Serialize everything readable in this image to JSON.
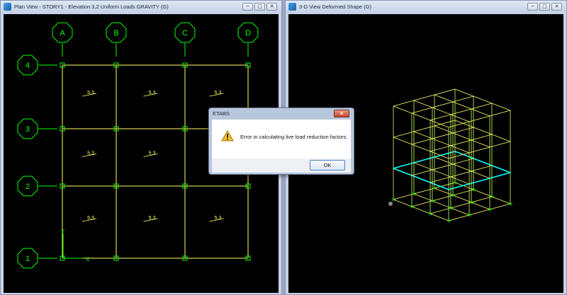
{
  "plan_window": {
    "title": "Plan View - STORY1 - Elevation 3,2  Uniform Loads GRAVITY   (G)",
    "grid_columns": [
      "A",
      "B",
      "C",
      "D"
    ],
    "grid_rows": [
      "4",
      "3",
      "2",
      "1"
    ],
    "load_label": "5.3",
    "axis_x_label": "X",
    "axis_y_label": "Y",
    "controls": {
      "minimize": "─",
      "maximize": "□",
      "close": "✕"
    }
  },
  "view3d_window": {
    "title": "3-D View  Deformed Shape (G)",
    "controls": {
      "minimize": "─",
      "maximize": "□",
      "close": "✕"
    }
  },
  "dialog": {
    "title": "ETABS",
    "message": "Error in calculating live load reduction factors.",
    "ok_label": "OK",
    "close_glyph": "✕"
  },
  "colors": {
    "background": "#000000",
    "grid_bubble": "#00ff00",
    "frame": "#ffff66",
    "highlight": "#00ffff",
    "window_chrome": "#c9d3e6"
  },
  "icons": {
    "app": "etabs-app-icon",
    "warning": "warning-triangle-icon"
  }
}
